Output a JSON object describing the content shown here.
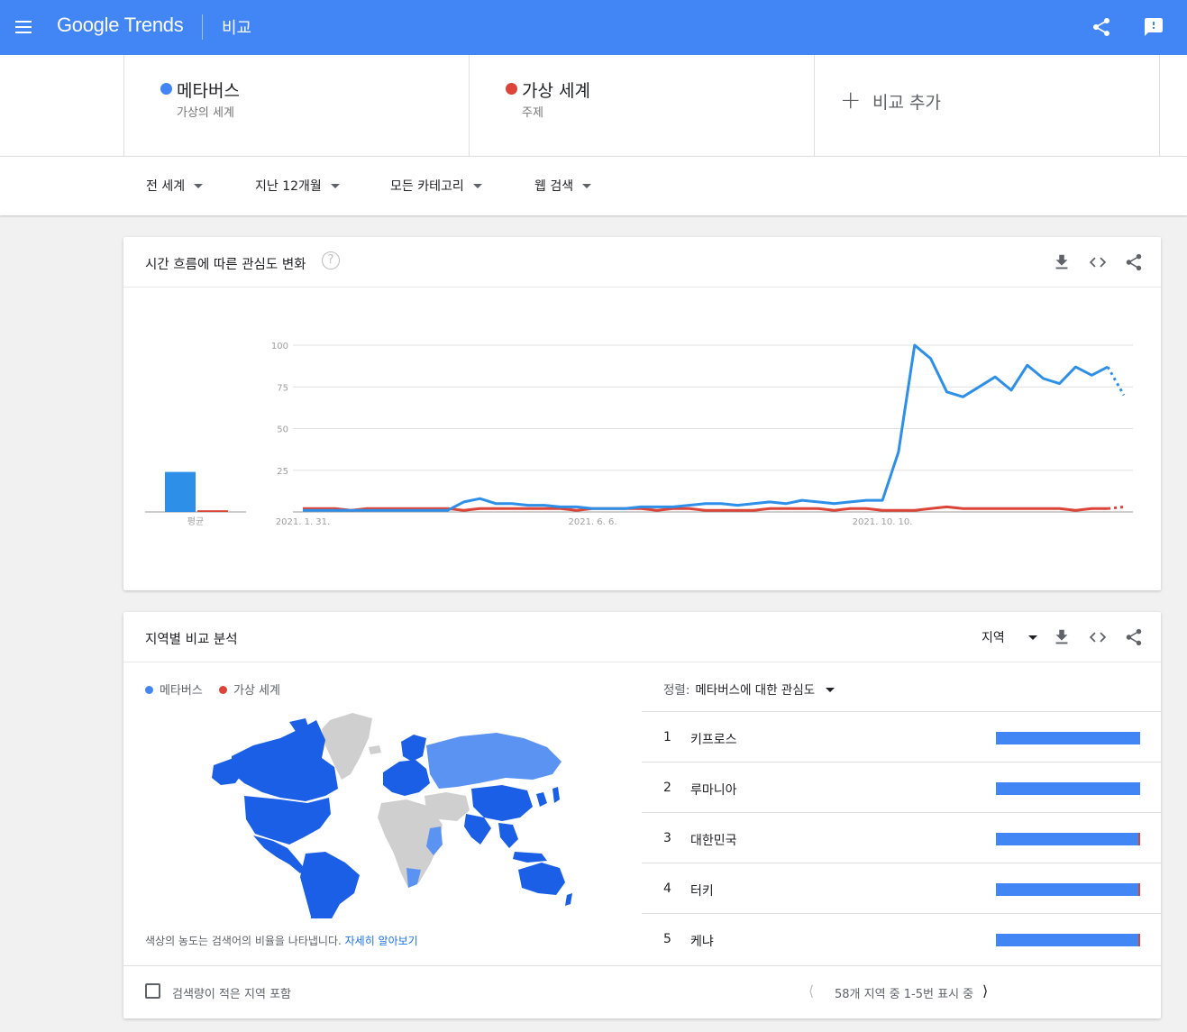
{
  "header": {
    "logo_google": "Google",
    "logo_trends": " Trends",
    "title": "비교",
    "bg_color": "#4285f4"
  },
  "terms": [
    {
      "name": "메타버스",
      "sub": "가상의 세계",
      "color": "#4285f4"
    },
    {
      "name": "가상 세계",
      "sub": "주제",
      "color": "#db4437"
    }
  ],
  "add_compare": {
    "label": "비교 추가",
    "icon": "plus-icon"
  },
  "filters": [
    {
      "label": "전 세계"
    },
    {
      "label": "지난 12개월"
    },
    {
      "label": "모든 카테고리"
    },
    {
      "label": "웹 검색"
    }
  ],
  "interest_over_time": {
    "title": "시간 흐름에 따른 관심도 변화",
    "help": "?",
    "average_label": "평균",
    "tools": [
      "download-icon",
      "embed-icon",
      "share-icon"
    ]
  },
  "chart_data": {
    "type": "line",
    "ylim": [
      0,
      100
    ],
    "yticks": [
      25,
      50,
      75,
      100
    ],
    "xtick_labels": [
      "2021. 1. 31.",
      "2021. 6. 6.",
      "2021. 10. 10."
    ],
    "xtick_index": [
      0,
      18,
      36
    ],
    "averages": [
      24,
      1
    ],
    "series": [
      {
        "name": "메타버스",
        "color": "#4285f4",
        "values": [
          1,
          1,
          1,
          1,
          1,
          1,
          1,
          1,
          1,
          1,
          6,
          8,
          5,
          5,
          4,
          4,
          3,
          3,
          2,
          2,
          2,
          3,
          3,
          3,
          4,
          5,
          5,
          4,
          5,
          6,
          5,
          7,
          6,
          5,
          6,
          7,
          7,
          36,
          100,
          92,
          72,
          69,
          75,
          81,
          73,
          88,
          80,
          77,
          87,
          82,
          87,
          70
        ],
        "partial_last": true
      },
      {
        "name": "가상 세계",
        "color": "#db4437",
        "values": [
          2,
          2,
          2,
          1,
          2,
          2,
          2,
          2,
          2,
          2,
          1,
          2,
          2,
          2,
          2,
          2,
          2,
          1,
          2,
          2,
          2,
          2,
          1,
          2,
          2,
          1,
          1,
          1,
          1,
          2,
          2,
          2,
          2,
          1,
          2,
          2,
          1,
          1,
          1,
          2,
          3,
          2,
          2,
          2,
          2,
          2,
          2,
          2,
          1,
          2,
          2,
          3
        ],
        "partial_last": true
      }
    ]
  },
  "region": {
    "title": "지역별 비교 분석",
    "dropdown_label": "지역",
    "legend": [
      "메타버스",
      "가상 세계"
    ],
    "map_note": "색상의 농도는 검색어의 비율을 나타냅니다.",
    "map_link": "자세히 알아보기",
    "sort_label": "정렬:",
    "sort_value": "메타버스에 대한 관심도",
    "rows": [
      {
        "rank": "1",
        "name": "키프로스",
        "share_metaverse": 100
      },
      {
        "rank": "2",
        "name": "루마니아",
        "share_metaverse": 100
      },
      {
        "rank": "3",
        "name": "대한민국",
        "share_metaverse": 99
      },
      {
        "rank": "4",
        "name": "터키",
        "share_metaverse": 99
      },
      {
        "rank": "5",
        "name": "케냐",
        "share_metaverse": 99
      }
    ],
    "low_volume_label": "검색량이 적은 지역 포함",
    "pager_text": "58개 지역 중 1-5번 표시 중"
  }
}
